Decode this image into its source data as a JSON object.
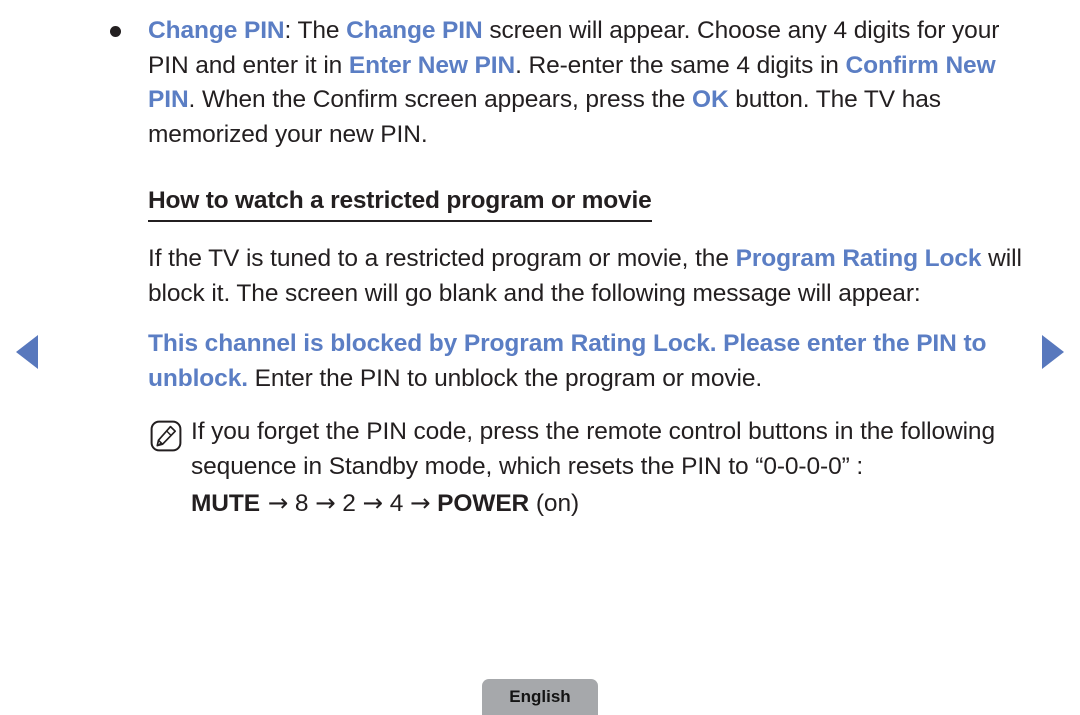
{
  "page": {
    "background_color": "#ffffff",
    "text_color": "#231f20",
    "accent_blue": "#5b7ec4",
    "arrow_blue": "#5878bd"
  },
  "bullet_item": {
    "bullet_glyph": "•",
    "term": "Change PIN",
    "seg1": ": The ",
    "term2": "Change PIN",
    "seg2": " screen will appear. Choose any 4 digits for your PIN and enter it in ",
    "term3": "Enter New PIN",
    "seg3": ". Re-enter the same 4 digits in ",
    "term4": "Confirm New PIN",
    "seg4": ". When the Confirm screen appears, press the ",
    "term5": "OK",
    "seg5": " button. The TV has memorized your new PIN."
  },
  "section": {
    "heading": "How to watch a restricted program or movie"
  },
  "intro_paragraph": {
    "seg1": "If the TV is tuned to a restricted program or movie, the ",
    "term1": "Program Rating Lock",
    "seg2": " will block it. The screen will go blank and the following message will appear:"
  },
  "blocked_message": {
    "message": "This channel is blocked by Program Rating Lock. Please enter the PIN to unblock.",
    "followup": " Enter the PIN to unblock the program or movie."
  },
  "note": {
    "icon_name": "note-pencil-icon",
    "line1": "If you forget the PIN code, press the remote control buttons in the following sequence in Standby mode, which resets the PIN to “0-0-0-0” :",
    "sequence": {
      "key1": "MUTE",
      "arrow": "→",
      "digit1": "8",
      "digit2": "2",
      "digit3": "4",
      "key2": "POWER",
      "state": " (on)"
    }
  },
  "navigation": {
    "prev_label": "prev-page-arrow",
    "next_label": "next-page-arrow"
  },
  "footer": {
    "language_label": "English"
  }
}
